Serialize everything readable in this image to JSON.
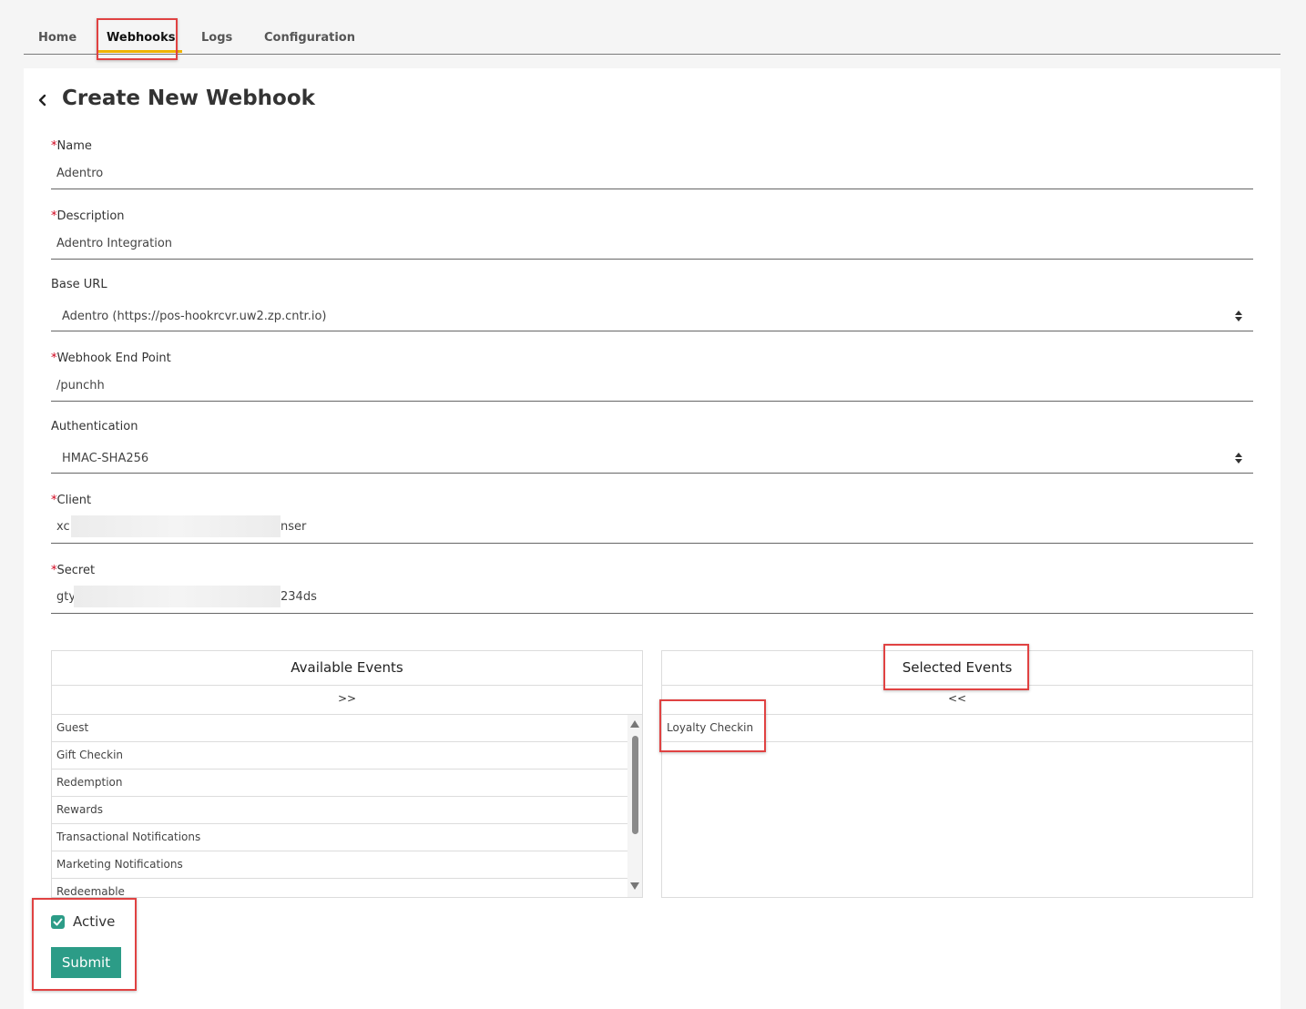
{
  "tabs": [
    {
      "label": "Home"
    },
    {
      "label": "Webhooks"
    },
    {
      "label": "Logs"
    },
    {
      "label": "Configuration"
    }
  ],
  "page": {
    "title": "Create New Webhook"
  },
  "form": {
    "required_mark": "*",
    "name": {
      "label": "Name",
      "value": "Adentro"
    },
    "description": {
      "label": "Description",
      "value": "Adentro Integration"
    },
    "base_url": {
      "label": "Base URL",
      "value": "Adentro (https://pos-hookrcvr.uw2.zp.cntr.io)"
    },
    "endpoint": {
      "label": "Webhook End Point",
      "value": "/punchh"
    },
    "authentication": {
      "label": "Authentication",
      "value": "HMAC-SHA256"
    },
    "client": {
      "label": "Client",
      "value_start": "xc",
      "value_end": "nser"
    },
    "secret": {
      "label": "Secret",
      "value_start": "gty",
      "value_end": "234ds"
    }
  },
  "available_events": {
    "title": "Available Events",
    "move_label": ">>",
    "items": [
      "Guest",
      "Gift Checkin",
      "Redemption",
      "Rewards",
      "Transactional Notifications",
      "Marketing Notifications",
      "Redeemable"
    ]
  },
  "selected_events": {
    "title": "Selected Events",
    "move_label": "<<",
    "items": [
      "Loyalty Checkin"
    ]
  },
  "active": {
    "label": "Active",
    "checked": true
  },
  "submit": {
    "label": "Submit"
  },
  "colors": {
    "accent": "#2c9c87",
    "tab_underline": "#f0b400",
    "highlight": "#e04242",
    "required": "#d0021b"
  }
}
